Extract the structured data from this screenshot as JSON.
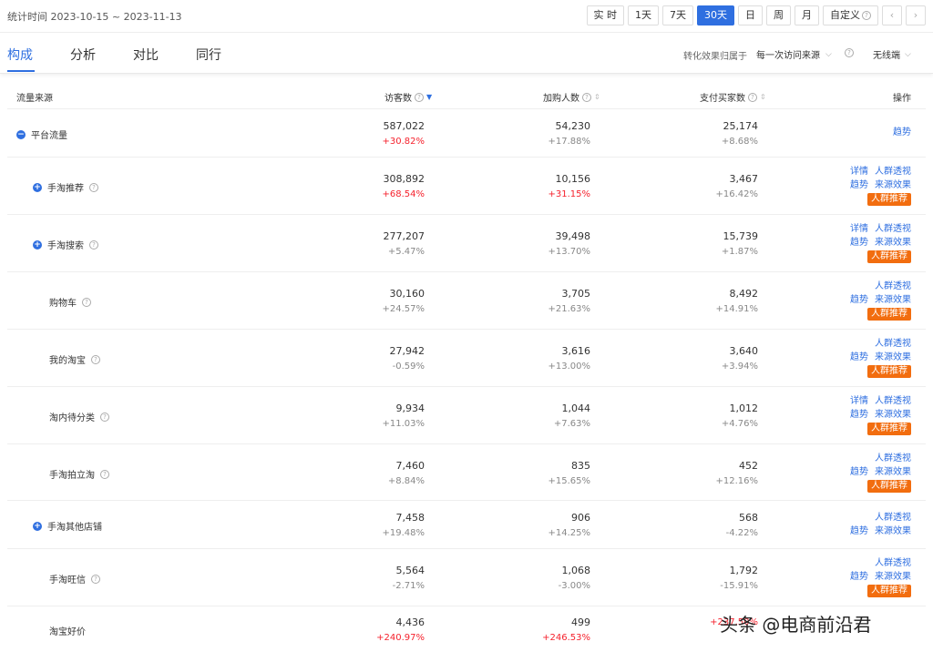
{
  "topbar": {
    "stat_time": "统计时间 2023-10-15 ~ 2023-11-13",
    "periods": [
      "实 时",
      "1天",
      "7天",
      "30天",
      "日",
      "周",
      "月"
    ],
    "custom_label": "自定义"
  },
  "tabs": [
    "构成",
    "分析",
    "对比",
    "同行"
  ],
  "attribution": {
    "label": "转化效果归属于",
    "value": "每一次访问来源",
    "device": "无线端"
  },
  "columns": {
    "source": "流量来源",
    "visitors": "访客数",
    "cart": "加购人数",
    "buyers": "支付买家数",
    "ops": "操作"
  },
  "ops_labels": {
    "detail": "详情",
    "crowd": "人群透视",
    "trend": "趋势",
    "effect": "来源效果",
    "rec": "人群推荐"
  },
  "rows": [
    {
      "name": "平台流量",
      "toggle": "−",
      "visitors": "587,022",
      "visitors_pct": "+30.82%",
      "cart": "54,230",
      "cart_pct": "+17.88%",
      "buyers": "25,174",
      "buyers_pct": "+8.68%"
    },
    {
      "name": "手淘推荐",
      "toggle": "+",
      "visitors": "308,892",
      "visitors_pct": "+68.54%",
      "cart": "10,156",
      "cart_pct": "+31.15%",
      "buyers": "3,467",
      "buyers_pct": "+16.42%"
    },
    {
      "name": "手淘搜索",
      "toggle": "+",
      "visitors": "277,207",
      "visitors_pct": "+5.47%",
      "cart": "39,498",
      "cart_pct": "+13.70%",
      "buyers": "15,739",
      "buyers_pct": "+1.87%"
    },
    {
      "name": "购物车",
      "toggle": "",
      "visitors": "30,160",
      "visitors_pct": "+24.57%",
      "cart": "3,705",
      "cart_pct": "+21.63%",
      "buyers": "8,492",
      "buyers_pct": "+14.91%"
    },
    {
      "name": "我的淘宝",
      "toggle": "",
      "visitors": "27,942",
      "visitors_pct": "-0.59%",
      "cart": "3,616",
      "cart_pct": "+13.00%",
      "buyers": "3,640",
      "buyers_pct": "+3.94%"
    },
    {
      "name": "淘内待分类",
      "toggle": "",
      "visitors": "9,934",
      "visitors_pct": "+11.03%",
      "cart": "1,044",
      "cart_pct": "+7.63%",
      "buyers": "1,012",
      "buyers_pct": "+4.76%"
    },
    {
      "name": "手淘拍立淘",
      "toggle": "",
      "visitors": "7,460",
      "visitors_pct": "+8.84%",
      "cart": "835",
      "cart_pct": "+15.65%",
      "buyers": "452",
      "buyers_pct": "+12.16%"
    },
    {
      "name": "手淘其他店铺",
      "toggle": "+",
      "visitors": "7,458",
      "visitors_pct": "+19.48%",
      "cart": "906",
      "cart_pct": "+14.25%",
      "buyers": "568",
      "buyers_pct": "-4.22%"
    },
    {
      "name": "手淘旺信",
      "toggle": "",
      "visitors": "5,564",
      "visitors_pct": "-2.71%",
      "cart": "1,068",
      "cart_pct": "-3.00%",
      "buyers": "1,792",
      "buyers_pct": "-15.91%"
    },
    {
      "name": "淘宝好价",
      "toggle": "",
      "visitors": "4,436",
      "visitors_pct": "+240.97%",
      "cart": "499",
      "cart_pct": "+246.53%",
      "buyers": "",
      "buyers_pct": "+237.50%"
    }
  ],
  "watermark": "头条 @电商前沿君",
  "colors": {
    "accent": "#2f6fe0",
    "up": "#f5222d",
    "rec": "#f26d0f"
  }
}
